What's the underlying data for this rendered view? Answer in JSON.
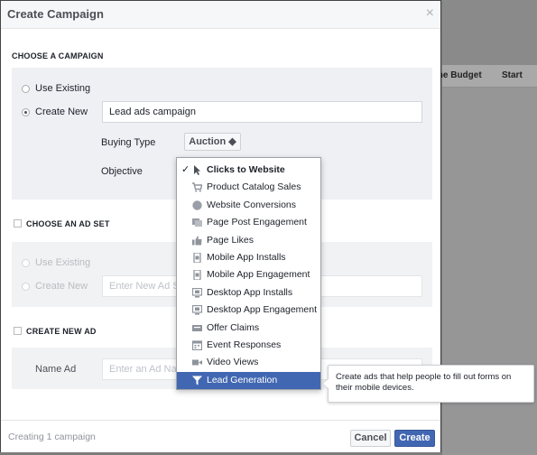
{
  "background": {
    "columns": [
      "me Budget",
      "Start"
    ]
  },
  "modal": {
    "title": "Create Campaign",
    "close": "×"
  },
  "campaign": {
    "section_title": "CHOOSE A CAMPAIGN",
    "use_existing": "Use Existing",
    "create_new": "Create New",
    "name_value": "Lead ads campaign",
    "buying_type_label": "Buying Type",
    "buying_type_value": "Auction ◆",
    "objective_label": "Objective"
  },
  "objective_menu": {
    "check": "✓",
    "items": [
      {
        "label": "Clicks to Website",
        "icon": "cursor-icon"
      },
      {
        "label": "Product Catalog Sales",
        "icon": "cart-icon"
      },
      {
        "label": "Website Conversions",
        "icon": "globe-icon"
      },
      {
        "label": "Page Post Engagement",
        "icon": "post-icon"
      },
      {
        "label": "Page Likes",
        "icon": "thumbs-up-icon"
      },
      {
        "label": "Mobile App Installs",
        "icon": "phone-icon"
      },
      {
        "label": "Mobile App Engagement",
        "icon": "phone-icon"
      },
      {
        "label": "Desktop App Installs",
        "icon": "monitor-icon"
      },
      {
        "label": "Desktop App Engagement",
        "icon": "monitor-icon"
      },
      {
        "label": "Offer Claims",
        "icon": "offer-icon"
      },
      {
        "label": "Event Responses",
        "icon": "calendar-icon"
      },
      {
        "label": "Video Views",
        "icon": "video-icon"
      },
      {
        "label": "Lead Generation",
        "icon": "funnel-icon"
      }
    ],
    "selected": "Clicks to Website",
    "highlighted": "Lead Generation"
  },
  "tooltip": {
    "text": "Create ads that help people to fill out forms on their mobile devices."
  },
  "ad_set": {
    "section_title": "CHOOSE AN AD SET",
    "use_existing": "Use Existing",
    "create_new": "Create New",
    "name_placeholder": "Enter New Ad Set Name"
  },
  "ad": {
    "section_title": "CREATE NEW AD",
    "name_label": "Name Ad",
    "name_placeholder": "Enter an Ad Name"
  },
  "footer": {
    "status": "Creating 1 campaign",
    "cancel": "Cancel",
    "create": "Create"
  },
  "colors": {
    "accent": "#4267b2",
    "panel": "#eef0f4"
  }
}
